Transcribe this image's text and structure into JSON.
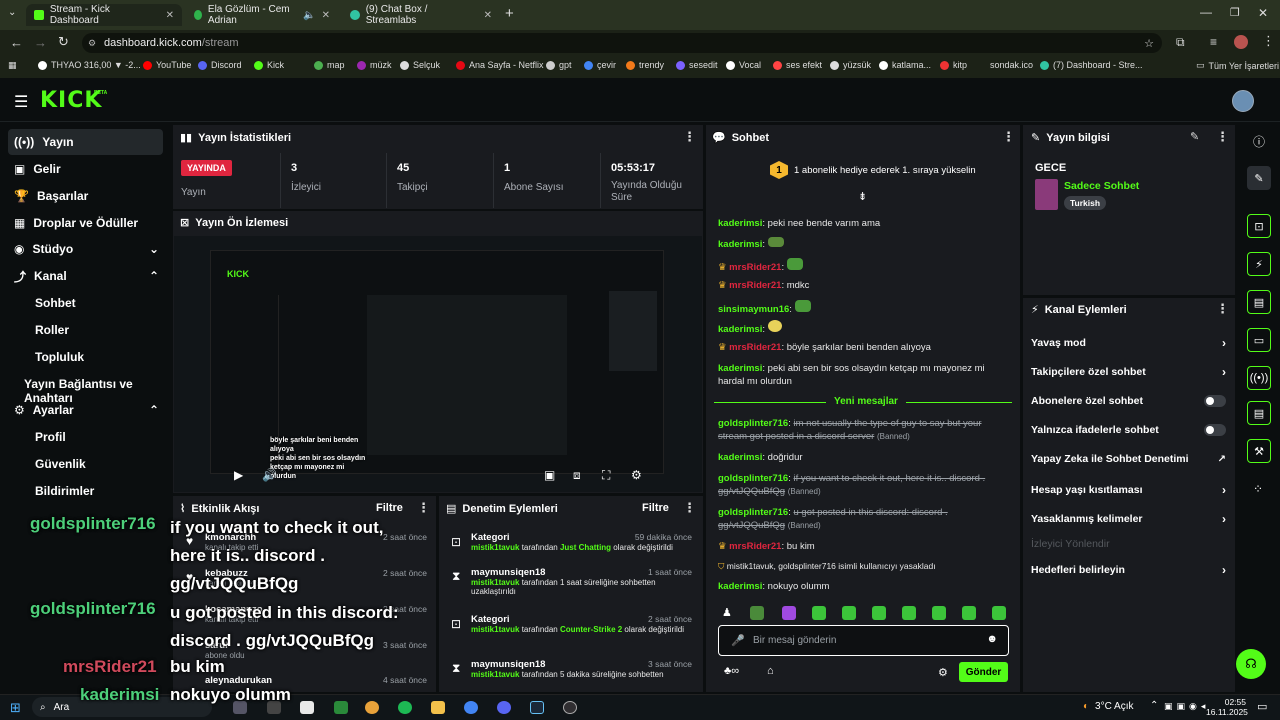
{
  "browser": {
    "tabs": [
      {
        "title": "Stream - Kick Dashboard",
        "active": true
      },
      {
        "title": "Ela Gözlüm - Cem Adrian",
        "active": false
      },
      {
        "title": "(9) Chat Box / Streamlabs",
        "active": false
      }
    ],
    "url_host": "dashboard.kick.com",
    "url_path": "/stream",
    "bookmarks": [
      "THYAO 316,00 ▼ -2...",
      "YouTube",
      "Discord",
      "Kick",
      "map",
      "müzk",
      "Selçuk",
      "Ana Sayfa - Netflix",
      "gpt",
      "çevir",
      "trendy",
      "sesedit",
      "Vocal",
      "ses efekt",
      "yüzsük",
      "katlama...",
      "kitp",
      "sondak.ico",
      "(7) Dashboard - Stre..."
    ],
    "all_bookmarks": "Tüm Yer İşaretleri"
  },
  "header": {
    "logo": "KICK",
    "beta": "BETA"
  },
  "sidebar": {
    "items": [
      {
        "icon": "broadcast-icon",
        "label": "Yayın",
        "selected": true
      },
      {
        "icon": "dollar-icon",
        "label": "Gelir"
      },
      {
        "icon": "trophy-icon",
        "label": "Başarılar"
      },
      {
        "icon": "gift-icon",
        "label": "Droplar ve Ödüller"
      },
      {
        "icon": "studio-icon",
        "label": "Stüdyo"
      },
      {
        "icon": "channel-icon",
        "label": "Kanal"
      },
      {
        "icon": "gear-icon",
        "label": "Ayarlar"
      }
    ],
    "channel_sub": [
      "Sohbet",
      "Roller",
      "Topluluk",
      "Yayın Bağlantısı ve Anahtarı"
    ],
    "settings_sub": [
      "Profil",
      "Güvenlik",
      "Bildirimler"
    ]
  },
  "stats": {
    "title": "Yayın İstatistikleri",
    "live_badge": "YAYINDA",
    "live_label": "Yayın",
    "items": [
      {
        "value": "3",
        "label": "İzleyici"
      },
      {
        "value": "45",
        "label": "Takipçi"
      },
      {
        "value": "1",
        "label": "Abone Sayısı"
      },
      {
        "value": "05:53:17",
        "label": "Yayında Olduğu Süre"
      }
    ]
  },
  "preview": {
    "title": "Yayın Ön İzlemesi",
    "overlay_lines": [
      "böyle şarkılar beni benden",
      "alıyoya",
      "peki abi sen bir sos olsaydın",
      "ketçap mı mayonez mi",
      "olurdun"
    ]
  },
  "activity": {
    "title": "Etkinlik Akışı",
    "filter": "Filtre",
    "events": [
      {
        "name": "kmonarchh",
        "sub": "kanalı takip etti",
        "time": "2 saat önce"
      },
      {
        "name": "kebabuzz",
        "sub": "kanalı takip etti",
        "time": "2 saat önce"
      },
      {
        "name": "kocamanuzo",
        "sub": "kanalı takip etti",
        "time": "2 saat önce"
      },
      {
        "name": "sarul",
        "sub": "abone oldu",
        "time": "3 saat önce"
      },
      {
        "name": "aleynadurukan",
        "sub": "",
        "time": "4 saat önce"
      }
    ]
  },
  "moderation": {
    "title": "Denetim Eylemleri",
    "filter": "Filtre",
    "items": [
      {
        "title": "Kategori",
        "time": "59 dakika önce",
        "actor": "mistik1tavuk",
        "pre": " tarafından ",
        "hl": "Just Chatting",
        "post": " olarak değiştirildi"
      },
      {
        "title": "maymunsiqen18",
        "time": "1 saat önce",
        "actor": "mistik1tavuk",
        "pre": " tarafından 1 saat süreliğine sohbetten uzaklaştırıldı",
        "hl": "",
        "post": ""
      },
      {
        "title": "Kategori",
        "time": "2 saat önce",
        "actor": "mistik1tavuk",
        "pre": " tarafından ",
        "hl": "Counter-Strike 2",
        "post": " olarak değiştirildi"
      },
      {
        "title": "maymunsiqen18",
        "time": "3 saat önce",
        "actor": "mistik1tavuk",
        "pre": " tarafından 5 dakika süreliğine sohbetten",
        "hl": "",
        "post": ""
      }
    ]
  },
  "chat": {
    "title": "Sohbet",
    "gift_rank": "1",
    "gift_text": "1 abonelik hediye ederek 1. sıraya yükselin",
    "new_messages": "Yeni mesajlar",
    "input_placeholder": "Bir mesaj gönderin",
    "send": "Gönder",
    "messages": [
      {
        "user": "kaderimsi",
        "text": "peki nee bende varım ama"
      },
      {
        "user": "kaderimsi",
        "text": ""
      },
      {
        "user": "mrsRider21",
        "text": ""
      },
      {
        "user": "mrsRider21",
        "text": "mdkc"
      },
      {
        "user": "sinsimaymun16",
        "text": ""
      },
      {
        "user": "kaderimsi",
        "text": ""
      },
      {
        "user": "mrsRider21",
        "text": "böyle şarkılar beni benden alıyoya"
      },
      {
        "user": "kaderimsi",
        "text": "peki abi sen bir sos olsaydın ketçap mı mayonez mi hardal mı olurdun"
      },
      {
        "user": "goldsplinter716",
        "text": "im not usually the type of guy to say but your stream got posted in a discord server",
        "banned": "(Banned)"
      },
      {
        "user": "kaderimsi",
        "text": "doğridur"
      },
      {
        "user": "goldsplinter716",
        "text": "if you want to check it out, here it is.. discord . gg/vtJQQuBfQg",
        "banned": "(Banned)"
      },
      {
        "user": "goldsplinter716",
        "text": "u got posted in this discord: discord . gg/vtJQQuBfQg",
        "banned": "(Banned)"
      },
      {
        "user": "mrsRider21",
        "text": "bu kim"
      },
      {
        "system": "mistik1tavuk, goldsplinter716 isimli kullanıcıyı yasakladı"
      },
      {
        "user": "kaderimsi",
        "text": "nokuyo olumm"
      }
    ]
  },
  "stream_info": {
    "title": "Yayın bilgisi",
    "stream_title": "GECE",
    "category": "Sadece Sohbet",
    "tag": "Turkish"
  },
  "channel_actions": {
    "title": "Kanal Eylemleri",
    "items": [
      {
        "label": "Yavaş mod",
        "kind": "chevron"
      },
      {
        "label": "Takipçilere özel sohbet",
        "kind": "chevron"
      },
      {
        "label": "Abonelere özel sohbet",
        "kind": "toggle"
      },
      {
        "label": "Yalnızca ifadelerle sohbet",
        "kind": "toggle"
      },
      {
        "label": "Yapay Zeka ile Sohbet Denetimi",
        "kind": "external"
      },
      {
        "label": "Hesap yaşı kısıtlaması",
        "kind": "chevron"
      },
      {
        "label": "Yasaklanmış kelimeler",
        "kind": "chevron"
      },
      {
        "label": "İzleyici Yönlendir",
        "kind": "disabled"
      },
      {
        "label": "Hedefleri belirleyin",
        "kind": "chevron"
      }
    ]
  },
  "overlay_chat": [
    {
      "user": "goldsplinter716",
      "text": "if you want to check it out, here it is.. discord . gg/vtJQQuBfQg"
    },
    {
      "user": "goldsplinter716",
      "text": "u got posted in this discord: discord . gg/vtJQQuBfQg"
    },
    {
      "user": "mrsRider21",
      "text": "bu kim"
    },
    {
      "user": "kaderimsi",
      "text": "nokuyo olumm"
    }
  ],
  "taskbar": {
    "search": "Ara",
    "weather": "3°C  Açık",
    "time": "02:55",
    "date": "16.11.2025"
  },
  "colors": {
    "brand": "#53fc18",
    "panel": "#191b1f",
    "page": "#0b0e0f",
    "mention": "#e0263f"
  }
}
